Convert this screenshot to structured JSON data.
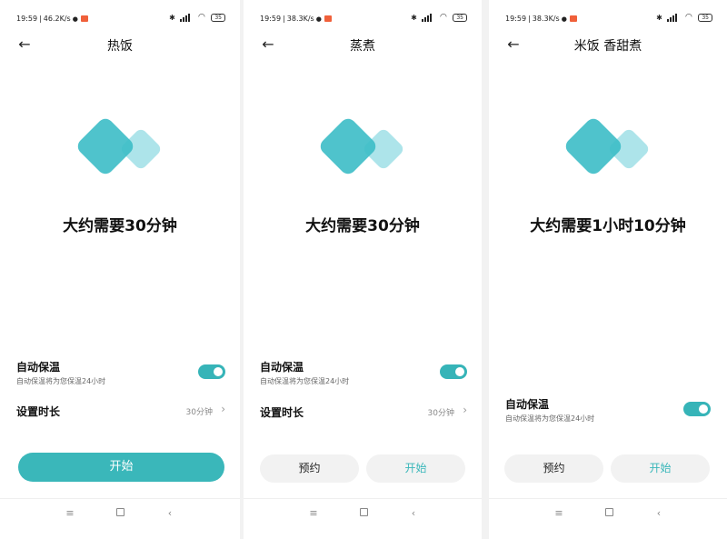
{
  "colors": {
    "accent": "#36b4b8",
    "diamond_primary": "#3cbcc6",
    "diamond_secondary": "#9fdfe6"
  },
  "screens": [
    {
      "status": {
        "time": "19:59",
        "speed": "46.2K/s",
        "battery": "35"
      },
      "title": "热饭",
      "estimate": "大约需要30分钟",
      "keep_warm": {
        "title": "自动保温",
        "desc": "自动保温将为您保温24小时",
        "on": true
      },
      "duration": {
        "label": "设置时长",
        "value": "30分钟"
      },
      "buttons": {
        "start": "开始"
      }
    },
    {
      "status": {
        "time": "19:59",
        "speed": "38.3K/s",
        "battery": "35"
      },
      "title": "蒸煮",
      "estimate": "大约需要30分钟",
      "keep_warm": {
        "title": "自动保温",
        "desc": "自动保温将为您保温24小时",
        "on": true
      },
      "duration": {
        "label": "设置时长",
        "value": "30分钟"
      },
      "buttons": {
        "reserve": "预约",
        "start": "开始"
      }
    },
    {
      "status": {
        "time": "19:59",
        "speed": "38.3K/s",
        "battery": "35"
      },
      "title": "米饭 香甜煮",
      "estimate": "大约需要1小时10分钟",
      "keep_warm": {
        "title": "自动保温",
        "desc": "自动保温将为您保温24小时",
        "on": true
      },
      "buttons": {
        "reserve": "预约",
        "start": "开始"
      }
    }
  ],
  "icons": {
    "back": "arrow-left-icon",
    "menu": "menu-icon",
    "home": "home-icon",
    "nav_back": "chevron-left-icon"
  }
}
